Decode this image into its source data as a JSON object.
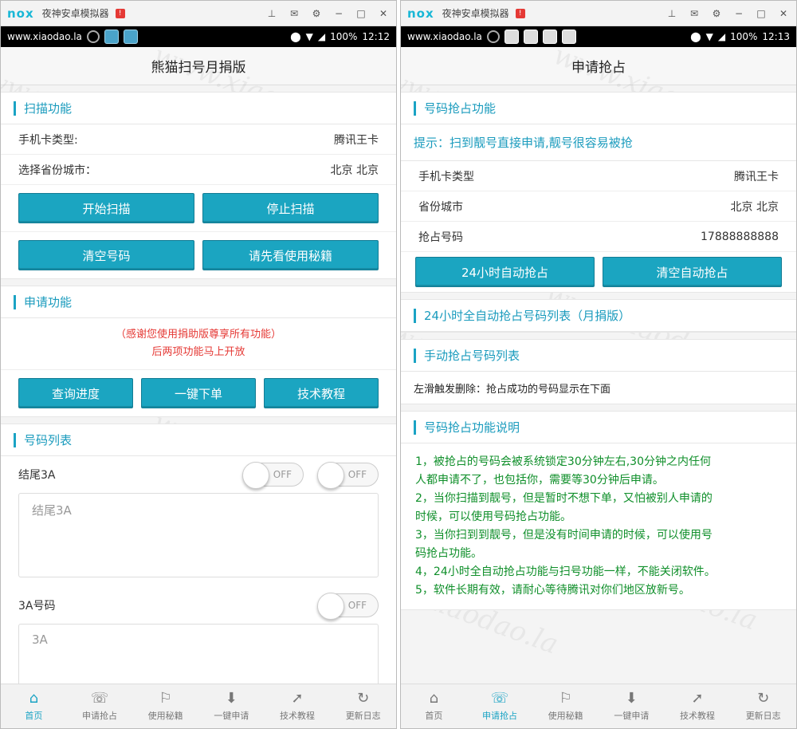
{
  "nox": {
    "logo": "nox",
    "title": "夜神安卓模拟器",
    "badge": "!"
  },
  "left": {
    "status": {
      "url": "www.xiaodao.la",
      "battery": "100%",
      "time": "12:12"
    },
    "header_title": "熊猫扫号月捐版",
    "scan_section": {
      "title": "扫描功能",
      "card_type_label": "手机卡类型:",
      "card_type_value": "腾讯王卡",
      "city_label": "选择省份城市：",
      "city_value": "北京 北京",
      "start_scan": "开始扫描",
      "stop_scan": "停止扫描",
      "clear_numbers": "清空号码",
      "read_guide": "请先看使用秘籍"
    },
    "apply_section": {
      "title": "申请功能",
      "notice_line1": "（感谢您使用捐助版尊享所有功能）",
      "notice_line2": "后两项功能马上开放",
      "query_progress": "查询进度",
      "one_click_order": "一键下单",
      "tech_tutorial": "技术教程"
    },
    "number_list": {
      "title": "号码列表",
      "row1_label": "结尾3A",
      "row1_toggle1": "OFF",
      "row1_toggle2": "OFF",
      "row1_text": "结尾3A",
      "row2_label": "3A号码",
      "row2_toggle": "OFF",
      "row2_text": "3A"
    },
    "nav": [
      "首页",
      "申请抢占",
      "使用秘籍",
      "一键申请",
      "技术教程",
      "更新日志"
    ]
  },
  "right": {
    "status": {
      "url": "www.xiaodao.la",
      "battery": "100%",
      "time": "12:13"
    },
    "header_title": "申请抢占",
    "grab_section": {
      "title": "号码抢占功能",
      "tip": "提示：扫到靓号直接申请,靓号很容易被抢",
      "card_type_label": "手机卡类型",
      "card_type_value": "腾讯王卡",
      "city_label": "省份城市",
      "city_value": "北京 北京",
      "grab_number_label": "抢占号码",
      "grab_number_value": "17888888888",
      "auto_grab_24h": "24小时自动抢占",
      "clear_auto_grab": "清空自动抢占"
    },
    "auto_list_title": "24小时全自动抢占号码列表（月捐版）",
    "manual_list_title": "手动抢占号码列表",
    "manual_hint": "左滑触发删除：抢占成功的号码显示在下面",
    "desc_title": "号码抢占功能说明",
    "desc_lines": [
      "1，被抢占的号码会被系统锁定30分钟左右,30分钟之内任何",
      "人都申请不了，也包括你，需要等30分钟后申请。",
      "2，当你扫描到靓号，但是暂时不想下单，又怕被别人申请的",
      "时候，可以使用号码抢占功能。",
      "3，当你扫到到靓号，但是没有时间申请的时候，可以使用号",
      "码抢占功能。",
      "4，24小时全自动抢占功能与扫号功能一样，不能关闭软件。",
      "5，软件长期有效，请耐心等待腾讯对你们地区放新号。"
    ],
    "nav": [
      "首页",
      "申请抢占",
      "使用秘籍",
      "一键申请",
      "技术教程",
      "更新日志"
    ]
  },
  "watermark": "www.xiaodao.la",
  "colors": {
    "accent": "#1aa3c4",
    "button": "#1ba5c1",
    "notice": "#e53935",
    "instructions": "#0f8f2a"
  },
  "icons": {
    "nav": [
      "home-icon",
      "phone-icon",
      "flag-icon",
      "download-icon",
      "compass-icon",
      "refresh-icon"
    ]
  }
}
